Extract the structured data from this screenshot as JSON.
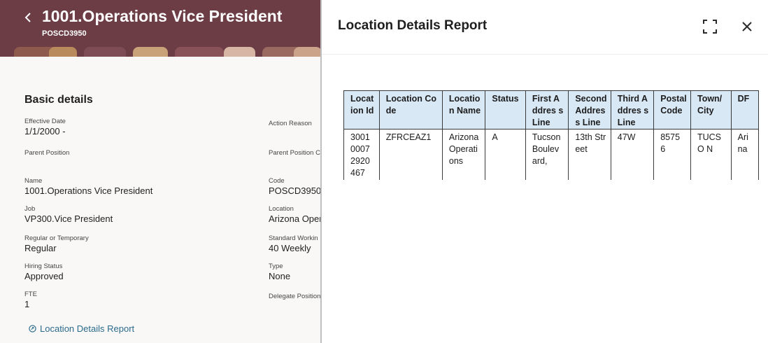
{
  "header": {
    "title": "1001.Operations Vice President",
    "subtitle": "POSCD3950",
    "back_icon": "chevron-left-icon",
    "background": "#6c3d45"
  },
  "basic_details": {
    "section_title": "Basic details",
    "fields": {
      "effective_date": {
        "label": "Effective Date",
        "value": "1/1/2000 -"
      },
      "action_reason": {
        "label": "Action Reason",
        "value": ""
      },
      "parent_position": {
        "label": "Parent Position",
        "value": ""
      },
      "parent_position_code": {
        "label": "Parent Position C",
        "value": ""
      },
      "name": {
        "label": "Name",
        "value": "1001.Operations Vice President"
      },
      "code": {
        "label": "Code",
        "value": "POSCD3950"
      },
      "job": {
        "label": "Job",
        "value": "VP300.Vice President"
      },
      "location": {
        "label": "Location",
        "value": "Arizona Oper"
      },
      "regular_temporary": {
        "label": "Regular or Temporary",
        "value": "Regular"
      },
      "standard_working": {
        "label": "Standard Workin",
        "value": "40 Weekly"
      },
      "hiring_status": {
        "label": "Hiring Status",
        "value": "Approved"
      },
      "type": {
        "label": "Type",
        "value": "None"
      },
      "fte": {
        "label": "FTE",
        "value": "1"
      },
      "delegate_position": {
        "label": "Delegate Position",
        "value": ""
      }
    },
    "report_link": "Location Details Report"
  },
  "report_panel": {
    "title": "Location Details Report",
    "expand_icon": "fullscreen-icon",
    "close_icon": "close-icon",
    "table": {
      "columns": [
        "Locat ion Id",
        "Location Code",
        "Locatio n Name",
        "Status",
        "First Addres s Line",
        "Second Addres s Line",
        "Third Addres s Line",
        "Postal Code",
        "Town/ City",
        "DF"
      ],
      "rows": [
        [
          "3001 0007 2920 467",
          "ZFRCEAZ1",
          "Arizona Operati ons",
          "A",
          "Tucson Boulev ard,",
          "13th Street",
          "47W",
          "8575 6",
          "TUCSO N",
          "Ari na"
        ]
      ],
      "header_color": "#d9e8f5"
    }
  }
}
